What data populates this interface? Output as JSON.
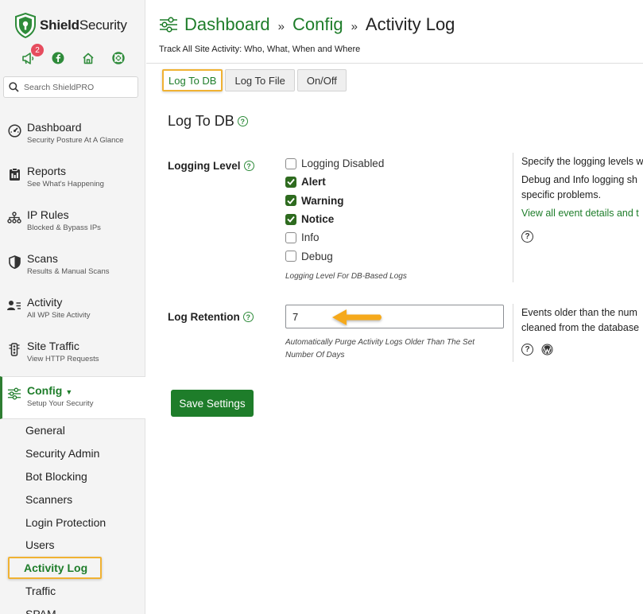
{
  "brand": {
    "name_bold": "Shield",
    "name_rest": "Security"
  },
  "notifications": {
    "count": "2"
  },
  "top_icons": [
    "megaphone-icon",
    "facebook-icon",
    "home-icon",
    "lifebuoy-icon"
  ],
  "search": {
    "placeholder": "Search ShieldPRO"
  },
  "sidebar": {
    "items": [
      {
        "title": "Dashboard",
        "subtitle": "Security Posture At A Glance",
        "icon": "dashboard-icon"
      },
      {
        "title": "Reports",
        "subtitle": "See What's Happening",
        "icon": "reports-icon"
      },
      {
        "title": "IP Rules",
        "subtitle": "Blocked & Bypass IPs",
        "icon": "ip-rules-icon"
      },
      {
        "title": "Scans",
        "subtitle": "Results & Manual Scans",
        "icon": "shield-icon"
      },
      {
        "title": "Activity",
        "subtitle": "All WP Site Activity",
        "icon": "activity-icon"
      },
      {
        "title": "Site Traffic",
        "subtitle": "View HTTP Requests",
        "icon": "traffic-icon"
      },
      {
        "title": "Config",
        "subtitle": "Setup Your Security",
        "icon": "config-icon",
        "active": true
      }
    ],
    "config_subitems": [
      "General",
      "Security Admin",
      "Bot Blocking",
      "Scanners",
      "Login Protection",
      "Users",
      "Activity Log",
      "Traffic",
      "SPAM"
    ]
  },
  "header": {
    "crumb1": "Dashboard",
    "crumb2": "Config",
    "current": "Activity Log",
    "separator": "»",
    "subtitle": "Track All Site Activity: Who, What, When and Where"
  },
  "tabs": [
    "Log To DB",
    "Log To File",
    "On/Off"
  ],
  "section": {
    "title": "Log To DB"
  },
  "logging_level": {
    "label": "Logging Level",
    "options": [
      {
        "label": "Logging Disabled",
        "checked": false
      },
      {
        "label": "Alert",
        "checked": true
      },
      {
        "label": "Warning",
        "checked": true
      },
      {
        "label": "Notice",
        "checked": true
      },
      {
        "label": "Info",
        "checked": false
      },
      {
        "label": "Debug",
        "checked": false
      }
    ],
    "hint": "Logging Level For DB-Based Logs",
    "desc_line1": "Specify the logging levels w",
    "desc_line2": "Debug and Info logging sh",
    "desc_line3": "specific problems.",
    "desc_link": "View all event details and t"
  },
  "log_retention": {
    "label": "Log Retention",
    "value": "7",
    "hint_line1": "Automatically Purge Activity Logs Older Than The Set",
    "hint_line2": "Number Of Days",
    "desc_line1": "Events older than the num",
    "desc_line2": "cleaned from the database"
  },
  "actions": {
    "save_label": "Save Settings"
  },
  "colors": {
    "accent_green": "#1e7d2a",
    "highlight_orange": "#f0b233",
    "badge_red": "#e64c5e"
  }
}
